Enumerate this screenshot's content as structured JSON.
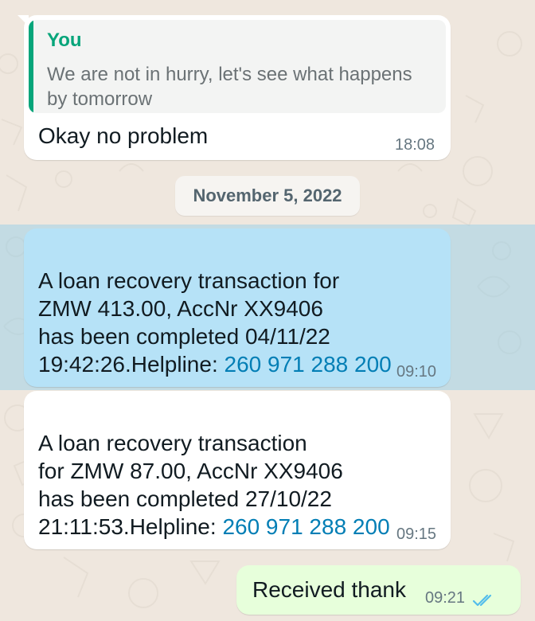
{
  "reply_message": {
    "quoted_author": "You",
    "quoted_text": "We are not in hurry, let's see what happens by tomorrow",
    "text": "Okay no problem",
    "time": "18:08"
  },
  "date_separator": "November 5, 2022",
  "message_1": {
    "text": "A loan recovery transaction for\nZMW 413.00, AccNr XX9406\nhas been completed 04/11/22\n19:42:26.Helpline:  ",
    "phone": "260 971 288 200",
    "time": "09:10"
  },
  "message_2": {
    "text": "A loan recovery transaction\nfor ZMW 87.00, AccNr XX9406\nhas been completed 27/10/22\n21:11:53.Helpline:  ",
    "phone": "260 971 288 200",
    "time": "09:15"
  },
  "message_3": {
    "text": "Received thank",
    "time": "09:21",
    "status_icon": "double-check-read-icon"
  },
  "colors": {
    "background": "#efe7de",
    "incoming_bubble": "#ffffff",
    "selected_bubble": "#b6e2f7",
    "outgoing_bubble": "#e7ffdb",
    "accent_green": "#06a57a",
    "link_blue": "#027eb5",
    "read_tick_blue": "#53bdeb"
  }
}
